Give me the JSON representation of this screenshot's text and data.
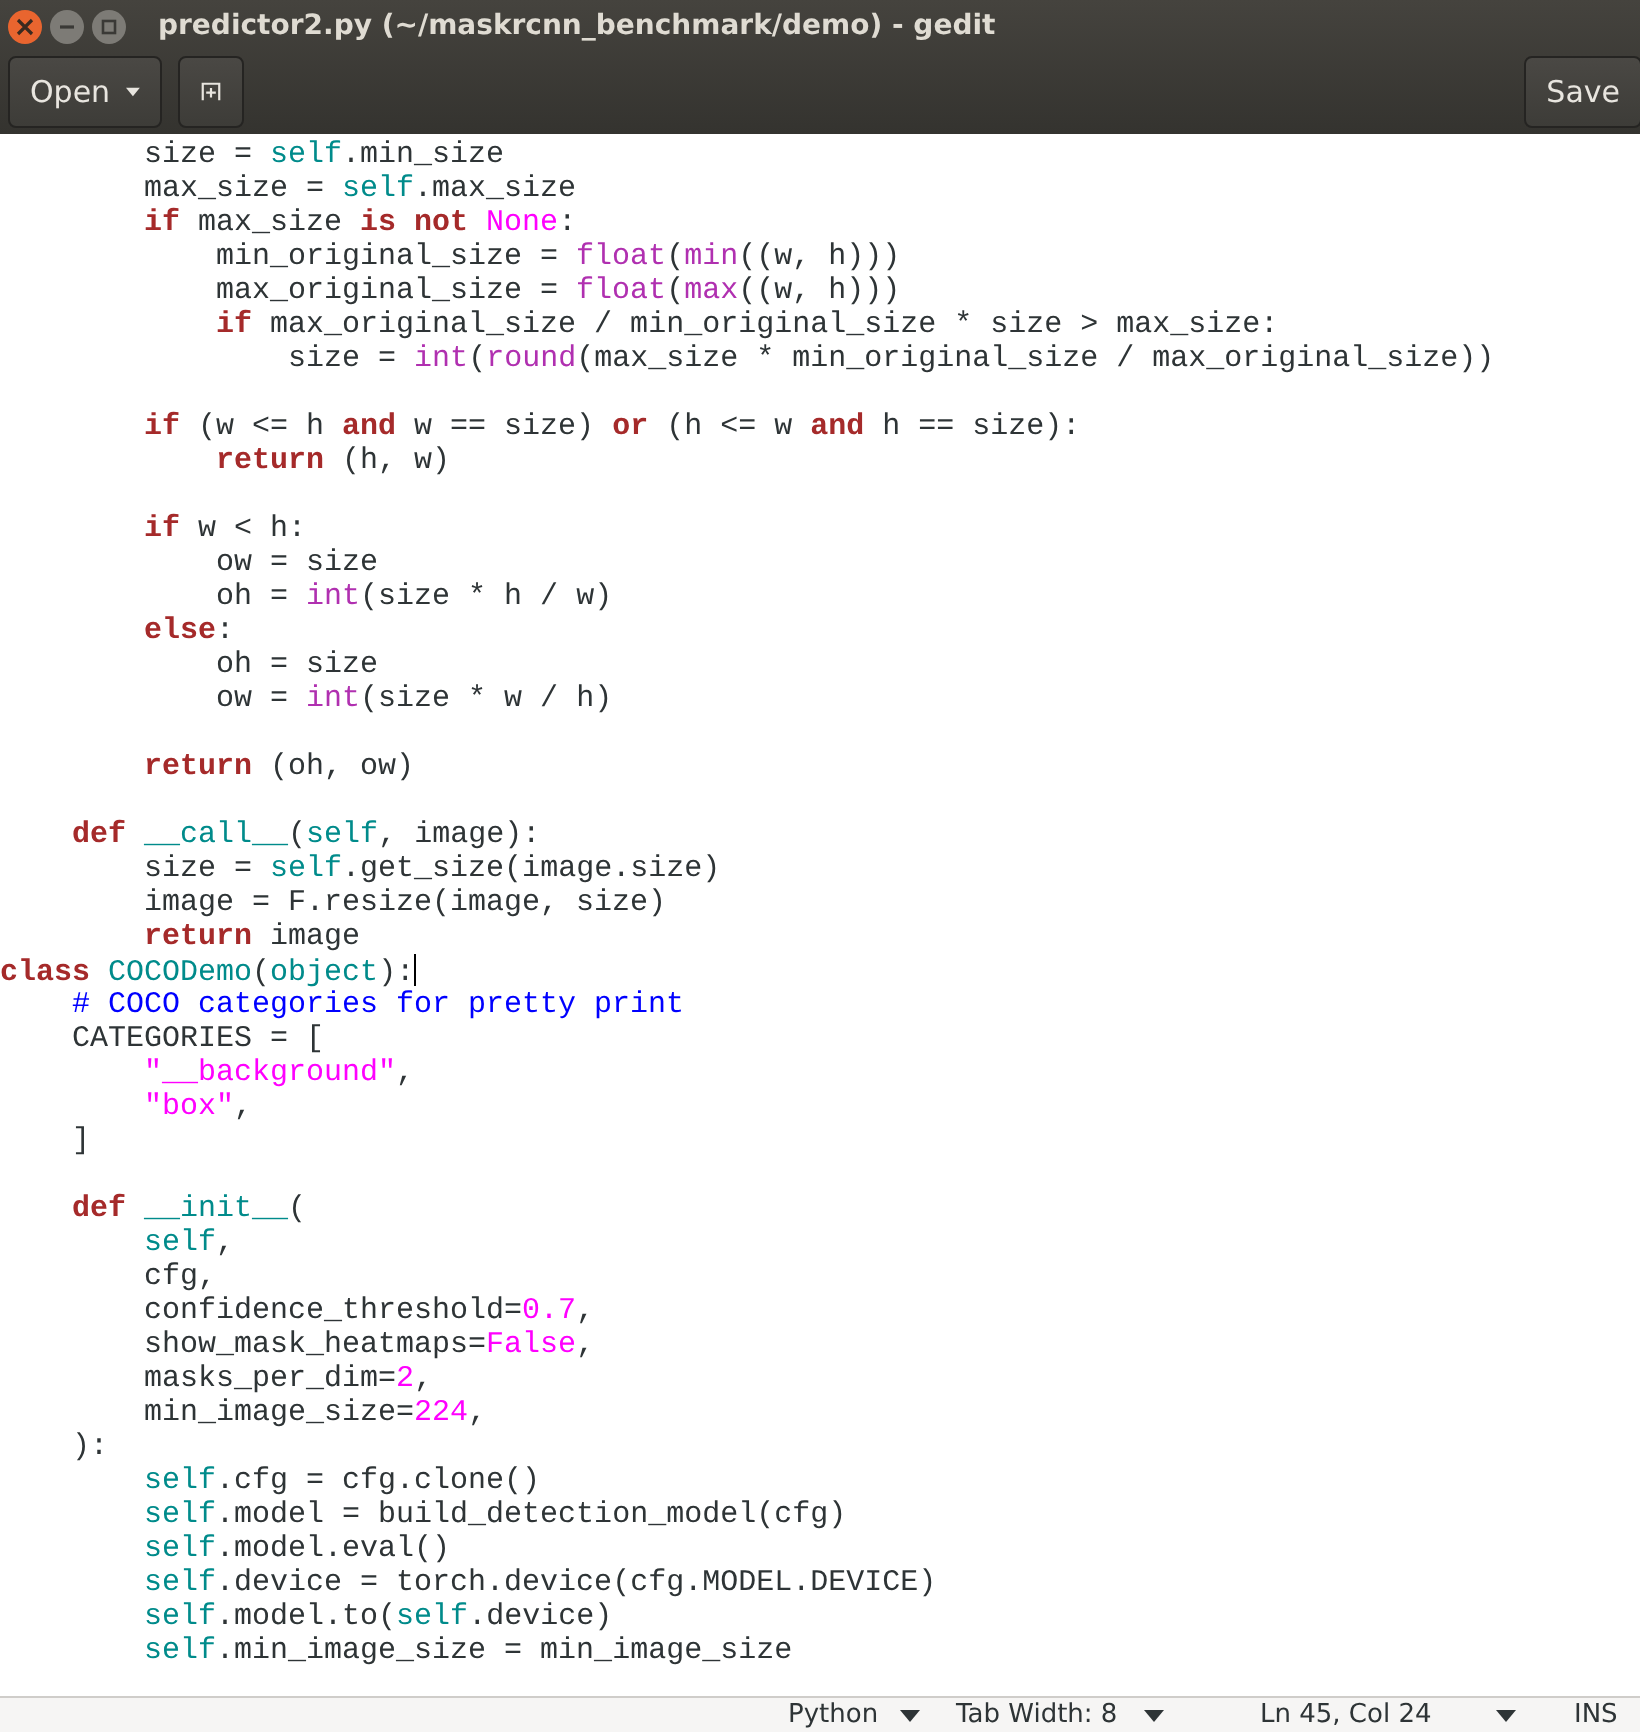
{
  "window": {
    "title": "predictor2.py (~/maskrcnn_benchmark/demo) - gedit"
  },
  "toolbar": {
    "open_button": "Open",
    "save_button": "Save"
  },
  "editor": {
    "lines": [
      {
        "kind": "code",
        "tokens": [
          {
            "kind": "plain",
            "text": "        size = "
          },
          {
            "kind": "self",
            "text": "self"
          },
          {
            "kind": "plain",
            "text": ".min_size"
          }
        ]
      },
      {
        "kind": "code",
        "tokens": [
          {
            "kind": "plain",
            "text": "        max_size = "
          },
          {
            "kind": "self",
            "text": "self"
          },
          {
            "kind": "plain",
            "text": ".max_size"
          }
        ]
      },
      {
        "kind": "code",
        "tokens": [
          {
            "kind": "keyword",
            "text": "        if"
          },
          {
            "kind": "plain",
            "text": " max_size "
          },
          {
            "kind": "keyword",
            "text": "is not"
          },
          {
            "kind": "constant",
            "text": " None"
          },
          {
            "kind": "plain",
            "text": ":"
          }
        ]
      },
      {
        "kind": "code",
        "tokens": [
          {
            "kind": "plain",
            "text": "            min_original_size = "
          },
          {
            "kind": "builtin",
            "text": "float"
          },
          {
            "kind": "plain",
            "text": "("
          },
          {
            "kind": "builtin",
            "text": "min"
          },
          {
            "kind": "plain",
            "text": "((w, h)))"
          }
        ]
      },
      {
        "kind": "code",
        "tokens": [
          {
            "kind": "plain",
            "text": "            max_original_size = "
          },
          {
            "kind": "builtin",
            "text": "float"
          },
          {
            "kind": "plain",
            "text": "("
          },
          {
            "kind": "builtin",
            "text": "max"
          },
          {
            "kind": "plain",
            "text": "((w, h)))"
          }
        ]
      },
      {
        "kind": "code",
        "tokens": [
          {
            "kind": "keyword",
            "text": "            if"
          },
          {
            "kind": "plain",
            "text": " max_original_size / min_original_size * size > max_size:"
          }
        ]
      },
      {
        "kind": "code",
        "tokens": [
          {
            "kind": "plain",
            "text": "                size = "
          },
          {
            "kind": "builtin",
            "text": "int"
          },
          {
            "kind": "plain",
            "text": "("
          },
          {
            "kind": "builtin",
            "text": "round"
          },
          {
            "kind": "plain",
            "text": "(max_size * min_original_size / max_original_size))"
          }
        ]
      },
      {
        "kind": "blank"
      },
      {
        "kind": "code",
        "tokens": [
          {
            "kind": "keyword",
            "text": "        if"
          },
          {
            "kind": "plain",
            "text": " (w <= h "
          },
          {
            "kind": "keyword",
            "text": "and"
          },
          {
            "kind": "plain",
            "text": " w == size) "
          },
          {
            "kind": "keyword",
            "text": "or"
          },
          {
            "kind": "plain",
            "text": " (h <= w "
          },
          {
            "kind": "keyword",
            "text": "and"
          },
          {
            "kind": "plain",
            "text": " h == size):"
          }
        ]
      },
      {
        "kind": "code",
        "tokens": [
          {
            "kind": "keyword",
            "text": "            return"
          },
          {
            "kind": "plain",
            "text": " (h, w)"
          }
        ]
      },
      {
        "kind": "blank"
      },
      {
        "kind": "code",
        "tokens": [
          {
            "kind": "keyword",
            "text": "        if"
          },
          {
            "kind": "plain",
            "text": " w < h:"
          }
        ]
      },
      {
        "kind": "code",
        "tokens": [
          {
            "kind": "plain",
            "text": "            ow = size"
          }
        ]
      },
      {
        "kind": "code",
        "tokens": [
          {
            "kind": "plain",
            "text": "            oh = "
          },
          {
            "kind": "builtin",
            "text": "int"
          },
          {
            "kind": "plain",
            "text": "(size * h / w)"
          }
        ]
      },
      {
        "kind": "code",
        "tokens": [
          {
            "kind": "keyword",
            "text": "        else"
          },
          {
            "kind": "plain",
            "text": ":"
          }
        ]
      },
      {
        "kind": "code",
        "tokens": [
          {
            "kind": "plain",
            "text": "            oh = size"
          }
        ]
      },
      {
        "kind": "code",
        "tokens": [
          {
            "kind": "plain",
            "text": "            ow = "
          },
          {
            "kind": "builtin",
            "text": "int"
          },
          {
            "kind": "plain",
            "text": "(size * w / h)"
          }
        ]
      },
      {
        "kind": "blank"
      },
      {
        "kind": "code",
        "tokens": [
          {
            "kind": "keyword",
            "text": "        return"
          },
          {
            "kind": "plain",
            "text": " (oh, ow)"
          }
        ]
      },
      {
        "kind": "blank"
      },
      {
        "kind": "code",
        "tokens": [
          {
            "kind": "keyword",
            "text": "    def"
          },
          {
            "kind": "name",
            "text": " __call__"
          },
          {
            "kind": "plain",
            "text": "("
          },
          {
            "kind": "self",
            "text": "self"
          },
          {
            "kind": "plain",
            "text": ", image):"
          }
        ]
      },
      {
        "kind": "code",
        "tokens": [
          {
            "kind": "plain",
            "text": "        size = "
          },
          {
            "kind": "self",
            "text": "self"
          },
          {
            "kind": "plain",
            "text": ".get_size(image.size)"
          }
        ]
      },
      {
        "kind": "code",
        "tokens": [
          {
            "kind": "plain",
            "text": "        image = F.resize(image, size)"
          }
        ]
      },
      {
        "kind": "code",
        "tokens": [
          {
            "kind": "keyword",
            "text": "        return"
          },
          {
            "kind": "plain",
            "text": " image"
          }
        ]
      },
      {
        "kind": "code",
        "cursor": true,
        "tokens": [
          {
            "kind": "keyword",
            "text": "class"
          },
          {
            "kind": "name",
            "text": " COCODemo"
          },
          {
            "kind": "plain",
            "text": "("
          },
          {
            "kind": "name",
            "text": "object"
          },
          {
            "kind": "plain",
            "text": "):"
          }
        ]
      },
      {
        "kind": "code",
        "tokens": [
          {
            "kind": "comment",
            "text": "    # COCO categories for pretty print"
          }
        ]
      },
      {
        "kind": "code",
        "tokens": [
          {
            "kind": "plain",
            "text": "    CATEGORIES = ["
          }
        ]
      },
      {
        "kind": "code",
        "tokens": [
          {
            "kind": "string",
            "text": "        \"__background\""
          },
          {
            "kind": "plain",
            "text": ","
          }
        ]
      },
      {
        "kind": "code",
        "tokens": [
          {
            "kind": "string",
            "text": "        \"box\""
          },
          {
            "kind": "plain",
            "text": ","
          }
        ]
      },
      {
        "kind": "code",
        "tokens": [
          {
            "kind": "plain",
            "text": "    ]"
          }
        ]
      },
      {
        "kind": "blank"
      },
      {
        "kind": "code",
        "tokens": [
          {
            "kind": "keyword",
            "text": "    def"
          },
          {
            "kind": "name",
            "text": " __init__"
          },
          {
            "kind": "plain",
            "text": "("
          }
        ]
      },
      {
        "kind": "code",
        "tokens": [
          {
            "kind": "self",
            "text": "        self"
          },
          {
            "kind": "plain",
            "text": ","
          }
        ]
      },
      {
        "kind": "code",
        "tokens": [
          {
            "kind": "plain",
            "text": "        cfg,"
          }
        ]
      },
      {
        "kind": "code",
        "tokens": [
          {
            "kind": "plain",
            "text": "        confidence_threshold="
          },
          {
            "kind": "number",
            "text": "0.7"
          },
          {
            "kind": "plain",
            "text": ","
          }
        ]
      },
      {
        "kind": "code",
        "tokens": [
          {
            "kind": "plain",
            "text": "        show_mask_heatmaps="
          },
          {
            "kind": "constant",
            "text": "False"
          },
          {
            "kind": "plain",
            "text": ","
          }
        ]
      },
      {
        "kind": "code",
        "tokens": [
          {
            "kind": "plain",
            "text": "        masks_per_dim="
          },
          {
            "kind": "number",
            "text": "2"
          },
          {
            "kind": "plain",
            "text": ","
          }
        ]
      },
      {
        "kind": "code",
        "tokens": [
          {
            "kind": "plain",
            "text": "        min_image_size="
          },
          {
            "kind": "number",
            "text": "224"
          },
          {
            "kind": "plain",
            "text": ","
          }
        ]
      },
      {
        "kind": "code",
        "tokens": [
          {
            "kind": "plain",
            "text": "    ):"
          }
        ]
      },
      {
        "kind": "code",
        "tokens": [
          {
            "kind": "self",
            "text": "        self"
          },
          {
            "kind": "plain",
            "text": ".cfg = cfg.clone()"
          }
        ]
      },
      {
        "kind": "code",
        "tokens": [
          {
            "kind": "self",
            "text": "        self"
          },
          {
            "kind": "plain",
            "text": ".model = build_detection_model(cfg)"
          }
        ]
      },
      {
        "kind": "code",
        "tokens": [
          {
            "kind": "self",
            "text": "        self"
          },
          {
            "kind": "plain",
            "text": ".model.eval()"
          }
        ]
      },
      {
        "kind": "code",
        "tokens": [
          {
            "kind": "self",
            "text": "        self"
          },
          {
            "kind": "plain",
            "text": ".device = torch.device(cfg.MODEL.DEVICE)"
          }
        ]
      },
      {
        "kind": "code",
        "tokens": [
          {
            "kind": "self",
            "text": "        self"
          },
          {
            "kind": "plain",
            "text": ".model.to("
          },
          {
            "kind": "self",
            "text": "self"
          },
          {
            "kind": "plain",
            "text": ".device)"
          }
        ]
      },
      {
        "kind": "code",
        "tokens": [
          {
            "kind": "self",
            "text": "        self"
          },
          {
            "kind": "plain",
            "text": ".min_image_size = min_image_size"
          }
        ]
      }
    ]
  },
  "status_bar": [
    {
      "kind": "dropdown",
      "label": "Python"
    },
    {
      "kind": "dropdown",
      "label": "Tab Width: 8"
    },
    {
      "kind": "dropdown",
      "label": "Ln 45, Col 24"
    },
    {
      "kind": "text",
      "label": "INS"
    }
  ]
}
